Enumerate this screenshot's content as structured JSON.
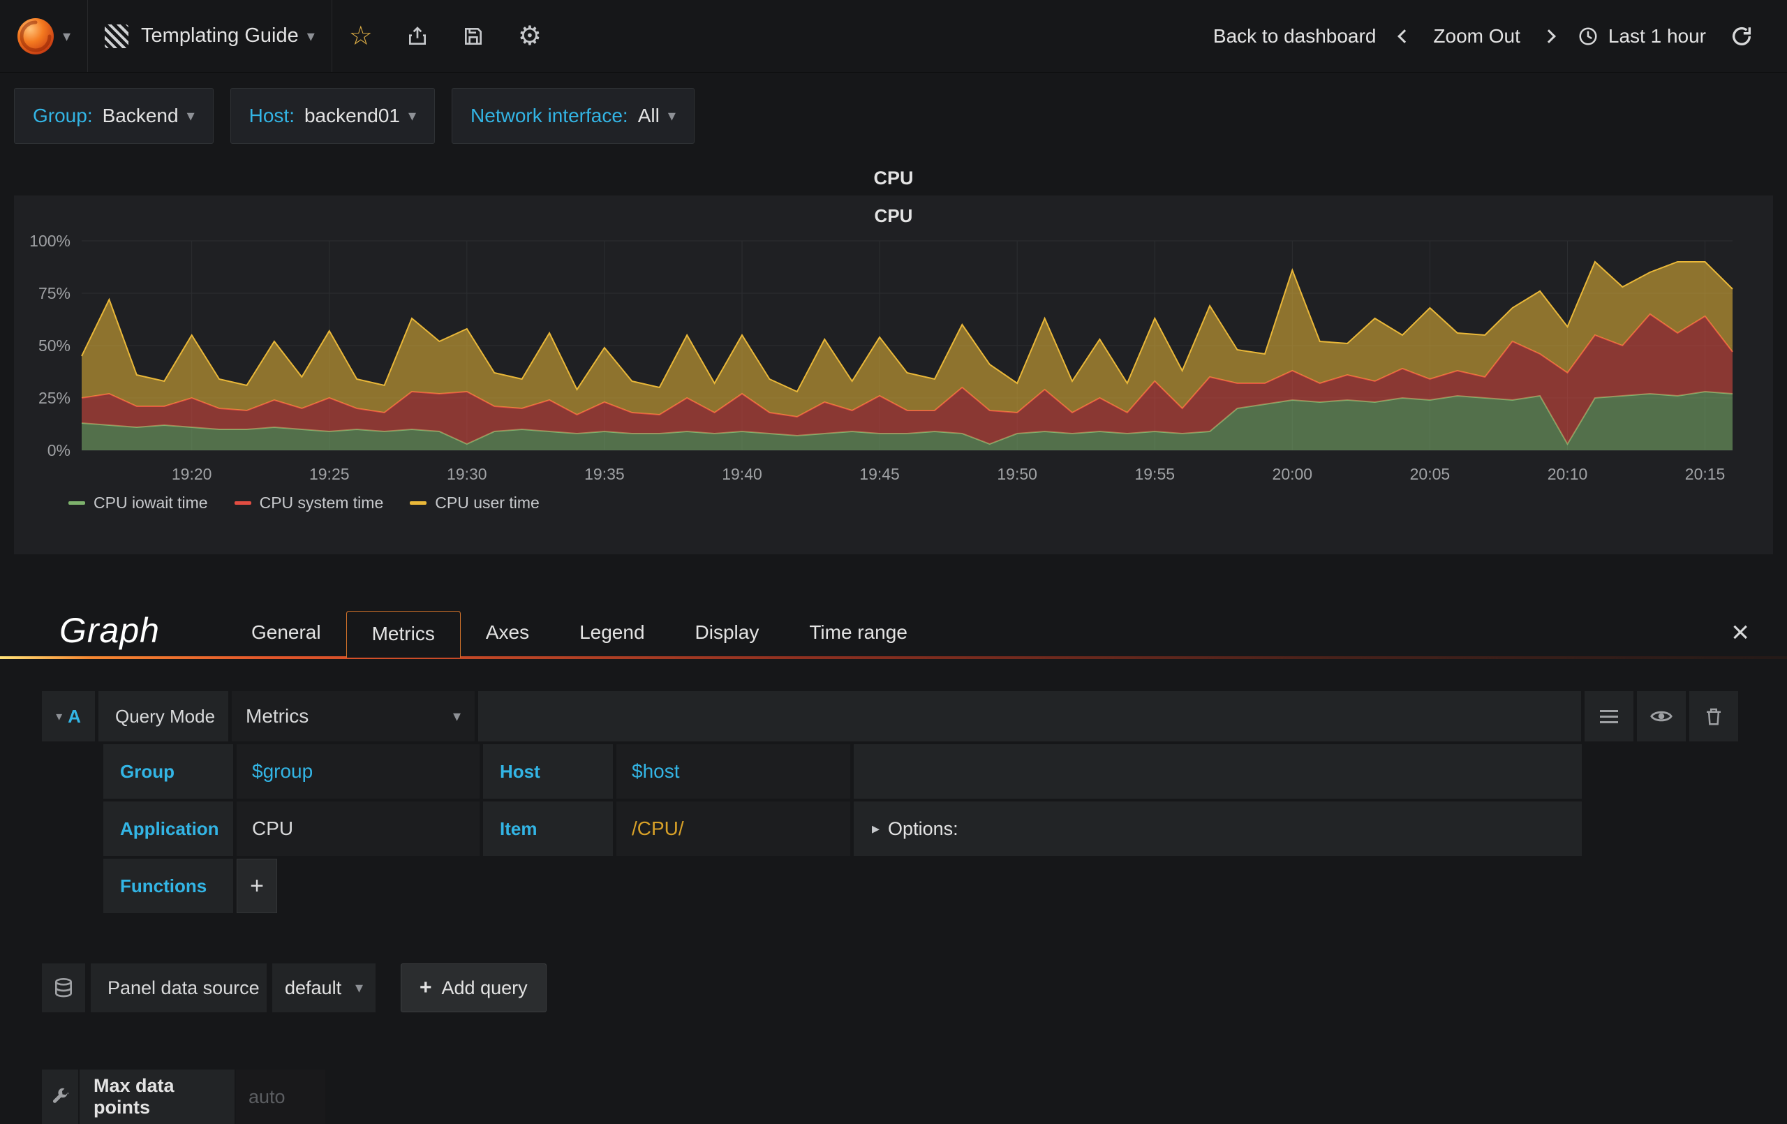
{
  "icons": {
    "caret_down": "▾",
    "star": "☆",
    "gear": "⚙",
    "close": "×",
    "options_caret": "▸",
    "plus": "+"
  },
  "colors": {
    "accent_cyan": "#33b5e5",
    "tab_accent_orange": "#d4732a",
    "series_green": "#7eb26d",
    "series_red": "#e24d42",
    "series_yellow": "#eab839",
    "item_value_yellow": "#d8a128"
  },
  "navbar": {
    "dashboard_title": "Templating Guide",
    "back_label": "Back to dashboard",
    "zoom_out_label": "Zoom Out",
    "time_label": "Last 1 hour"
  },
  "variables": [
    {
      "label": "Group:",
      "value": "Backend"
    },
    {
      "label": "Host:",
      "value": "backend01"
    },
    {
      "label": "Network interface:",
      "value": "All"
    }
  ],
  "panel": {
    "header_title": "CPU",
    "chart_title": "CPU"
  },
  "chart_data": {
    "type": "area",
    "stacked": true,
    "title": "CPU",
    "ylabel": "",
    "xlabel": "",
    "ylim": [
      0,
      100
    ],
    "grid": true,
    "legend_position": "bottom-left",
    "y_ticks": [
      "0%",
      "25%",
      "50%",
      "75%",
      "100%"
    ],
    "y_tick_values": [
      0,
      25,
      50,
      75,
      100
    ],
    "x_tick_labels": [
      "19:20",
      "19:25",
      "19:30",
      "19:35",
      "19:40",
      "19:45",
      "19:50",
      "19:55",
      "20:00",
      "20:05",
      "20:10",
      "20:15"
    ],
    "x_tick_indices": [
      4,
      9,
      14,
      19,
      24,
      29,
      34,
      39,
      44,
      49,
      54,
      59
    ],
    "x_start": "19:16",
    "x_step_minutes": 1,
    "series": [
      {
        "name": "CPU iowait time",
        "color": "#7eb26d",
        "values": [
          13,
          12,
          11,
          12,
          11,
          10,
          10,
          11,
          10,
          9,
          10,
          9,
          10,
          9,
          3,
          9,
          10,
          9,
          8,
          9,
          8,
          8,
          9,
          8,
          9,
          8,
          7,
          8,
          9,
          8,
          8,
          9,
          8,
          3,
          8,
          9,
          8,
          9,
          8,
          9,
          8,
          9,
          20,
          22,
          24,
          23,
          24,
          23,
          25,
          24,
          26,
          25,
          24,
          26,
          3,
          25,
          26,
          27,
          26,
          28,
          27
        ]
      },
      {
        "name": "CPU system time",
        "color": "#e24d42",
        "values": [
          12,
          15,
          10,
          9,
          14,
          10,
          9,
          13,
          10,
          16,
          10,
          9,
          18,
          18,
          25,
          12,
          10,
          15,
          9,
          14,
          10,
          9,
          16,
          10,
          18,
          10,
          9,
          15,
          10,
          18,
          11,
          10,
          22,
          16,
          10,
          20,
          10,
          16,
          10,
          24,
          12,
          26,
          12,
          10,
          14,
          9,
          12,
          10,
          14,
          10,
          12,
          10,
          28,
          20,
          34,
          30,
          24,
          38,
          30,
          36,
          20
        ]
      },
      {
        "name": "CPU user time",
        "color": "#eab839",
        "values": [
          20,
          45,
          15,
          12,
          30,
          14,
          12,
          28,
          15,
          32,
          14,
          13,
          35,
          25,
          30,
          16,
          14,
          32,
          12,
          26,
          15,
          13,
          30,
          14,
          28,
          16,
          12,
          30,
          14,
          28,
          18,
          15,
          30,
          22,
          14,
          34,
          15,
          28,
          14,
          30,
          18,
          34,
          16,
          14,
          48,
          20,
          15,
          30,
          16,
          34,
          18,
          20,
          16,
          30,
          22,
          35,
          28,
          20,
          34,
          26,
          30
        ]
      }
    ]
  },
  "editor": {
    "panel_type": "Graph",
    "tabs": [
      "General",
      "Metrics",
      "Axes",
      "Legend",
      "Display",
      "Time range"
    ],
    "active_tab": "Metrics",
    "query": {
      "letter": "A",
      "mode_label": "Query Mode",
      "mode_value": "Metrics",
      "row1": {
        "label1": "Group",
        "value1": "$group",
        "label2": "Host",
        "value2": "$host"
      },
      "row2": {
        "label1": "Application",
        "value1": "CPU",
        "label2": "Item",
        "value2": "/CPU/"
      },
      "options_label": "Options:",
      "functions_label": "Functions"
    },
    "datasource": {
      "label": "Panel data source",
      "value": "default",
      "add_query_label": "Add query"
    },
    "max_data_points": {
      "label": "Max data points",
      "placeholder": "auto"
    }
  }
}
